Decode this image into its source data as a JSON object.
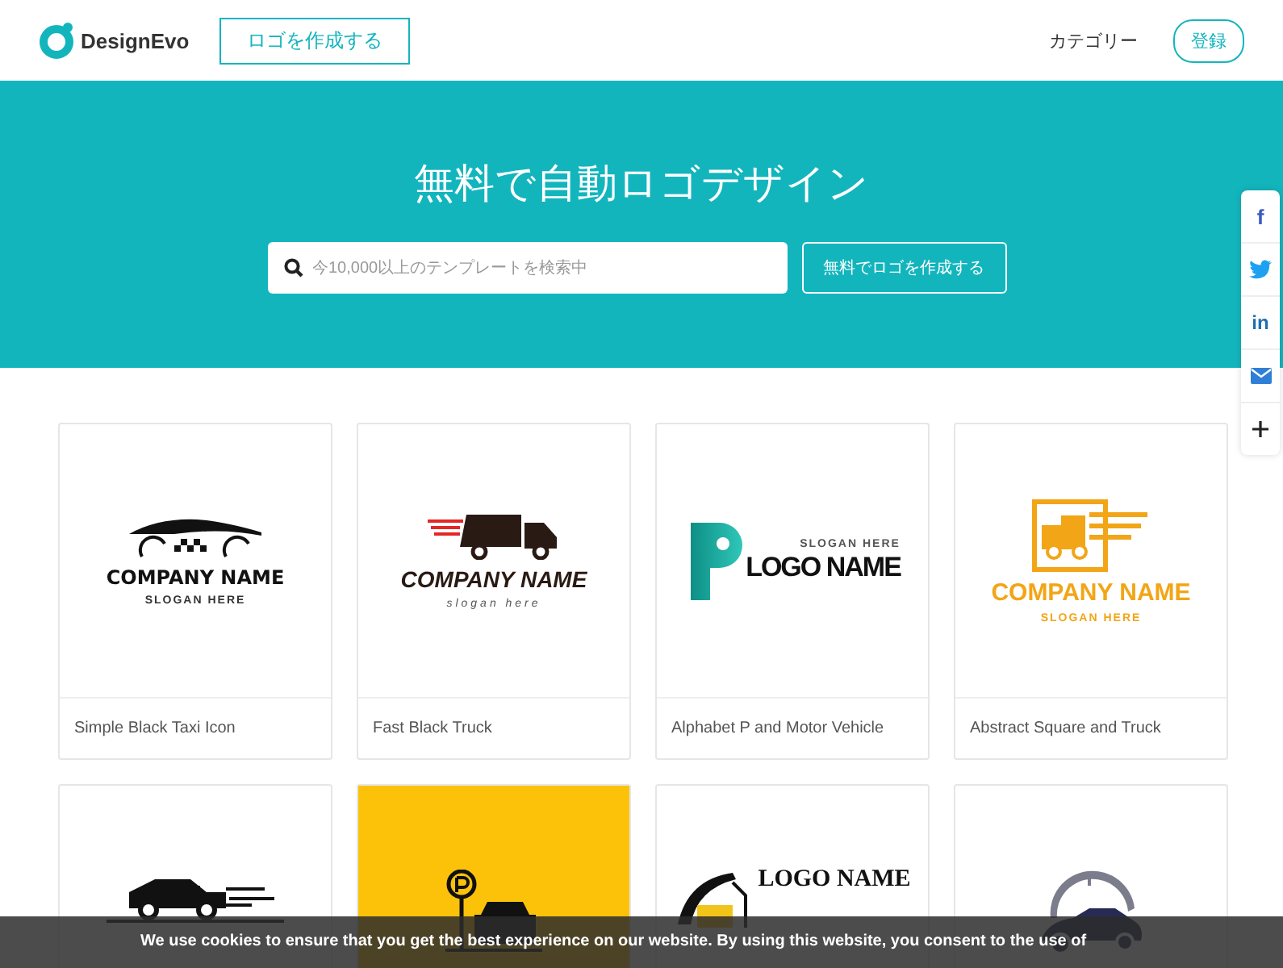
{
  "header": {
    "brand": "DesignEvo",
    "create_button": "ロゴを作成する",
    "nav_link": "カテゴリー",
    "signup_button": "登録"
  },
  "hero": {
    "title": "無料で自動ロゴデザイン",
    "search": {
      "placeholder": "今10,000以上のテンプレートを検索中"
    },
    "cta_button": "無料でロゴを作成する"
  },
  "social": [
    {
      "kind": "facebook",
      "glyph": "f"
    },
    {
      "kind": "twitter"
    },
    {
      "kind": "linkedin",
      "glyph": "in"
    },
    {
      "kind": "email"
    },
    {
      "kind": "more"
    }
  ],
  "templates": [
    {
      "kind": "taxi",
      "name": "COMPANY NAME",
      "slogan": "SLOGAN HERE",
      "caption": "Simple Black Taxi Icon"
    },
    {
      "kind": "truck",
      "name": "COMPANY NAME",
      "slogan": "slogan here",
      "caption": "Fast Black Truck"
    },
    {
      "kind": "p-car",
      "name": "LOGO NAME",
      "slogan": "SLOGAN HERE",
      "caption": "Alphabet P and Motor Vehicle"
    },
    {
      "kind": "square-truck",
      "name": "COMPANY NAME",
      "slogan": "SLOGAN HERE",
      "caption": "Abstract Square and Truck"
    },
    {
      "kind": "speed-taxi"
    },
    {
      "kind": "parking"
    },
    {
      "kind": "tow",
      "name": "LOGO NAME"
    },
    {
      "kind": "dial-car"
    }
  ],
  "cookie_notice": "We use cookies to ensure that you get the best experience on our website. By using this website, you consent to the use of"
}
